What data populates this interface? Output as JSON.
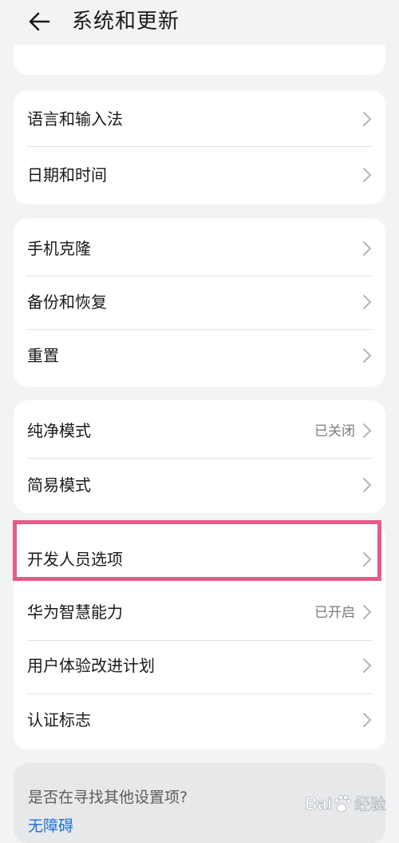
{
  "header": {
    "title": "系统和更新",
    "back_icon": "arrow-left-icon"
  },
  "cards": [
    {
      "rows": [
        {
          "label": "语言和输入法",
          "value": ""
        },
        {
          "label": "日期和时间",
          "value": ""
        }
      ]
    },
    {
      "rows": [
        {
          "label": "手机克隆",
          "value": ""
        },
        {
          "label": "备份和恢复",
          "value": ""
        },
        {
          "label": "重置",
          "value": ""
        }
      ]
    },
    {
      "rows": [
        {
          "label": "纯净模式",
          "value": "已关闭"
        },
        {
          "label": "简易模式",
          "value": ""
        }
      ]
    },
    {
      "rows": [
        {
          "label": "开发人员选项",
          "value": ""
        },
        {
          "label": "华为智慧能力",
          "value": "已开启"
        },
        {
          "label": "用户体验改进计划",
          "value": ""
        },
        {
          "label": "认证标志",
          "value": ""
        }
      ]
    }
  ],
  "footer": {
    "question": "是否在寻找其他设置项?",
    "link": "无障碍"
  },
  "watermark": {
    "text": "Bai 经验",
    "brand": "baidu-paw-icon"
  },
  "colors": {
    "background": "#f1f3f5",
    "card": "#ffffff",
    "highlight": "#e65a8c",
    "link": "#1d6fe0",
    "secondary_text": "#7b7b7b"
  }
}
